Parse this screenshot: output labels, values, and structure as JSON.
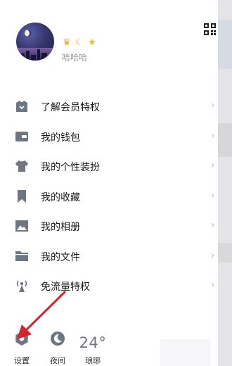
{
  "profile": {
    "nickname": "哈哈哈",
    "badges": [
      "crown-icon",
      "moon-icon",
      "star-icon"
    ]
  },
  "menu": {
    "items": [
      {
        "label": "了解会员特权",
        "icon": "vip-icon"
      },
      {
        "label": "我的钱包",
        "icon": "wallet-icon"
      },
      {
        "label": "我的个性装扮",
        "icon": "tshirt-icon"
      },
      {
        "label": "我的收藏",
        "icon": "bookmark-icon"
      },
      {
        "label": "我的相册",
        "icon": "photo-icon"
      },
      {
        "label": "我的文件",
        "icon": "folder-icon"
      },
      {
        "label": "免流量特权",
        "icon": "antenna-icon"
      }
    ]
  },
  "bottom": {
    "settings_label": "设置",
    "night_label": "夜间",
    "temperature": "24°",
    "city": "琅琊"
  },
  "colors": {
    "icon_gray": "#6e7682",
    "annotation_arrow": "#d4242a"
  }
}
